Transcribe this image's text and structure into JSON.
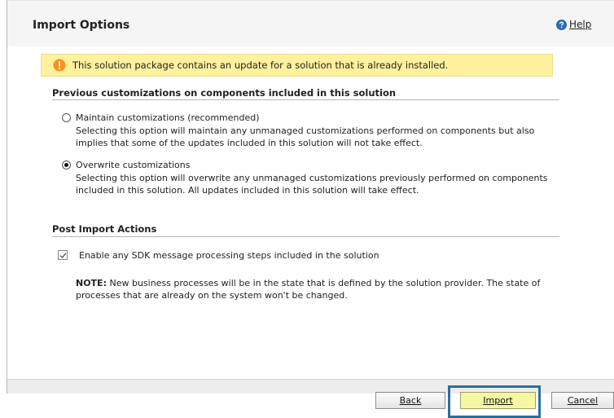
{
  "header": {
    "title": "Import Options",
    "help_label": "Help"
  },
  "warning": {
    "text": "This solution package contains an update for a solution that is already installed.",
    "icon": "warning-icon",
    "color": "#fff19d"
  },
  "customizations": {
    "heading": "Previous customizations on components included in this solution",
    "options": [
      {
        "label": "Maintain customizations (recommended)",
        "description_line1": "Selecting this option will maintain any unmanaged customizations performed on components but also",
        "description_line2": "implies that some of the updates included in this solution will not take effect.",
        "selected": false
      },
      {
        "label": "Overwrite customizations",
        "description_line1": "Selecting this option will overwrite any unmanaged customizations previously performed on components",
        "description_line2": "included in this solution. All updates included in this solution will take effect.",
        "selected": true
      }
    ]
  },
  "post_import": {
    "heading": "Post Import Actions",
    "checkbox_label": "Enable any SDK message processing steps included in the solution",
    "checkbox_checked": true,
    "note_prefix": "NOTE:",
    "note_line1": " New business processes will be in the state that is defined by the solution provider. The state of",
    "note_line2": "processes that are already on the system won't be changed."
  },
  "footer": {
    "back_label": "Back",
    "import_label": "Import",
    "cancel_label": "Cancel",
    "import_color": "#f6f7a4",
    "focus_color": "#2b6f9e"
  }
}
